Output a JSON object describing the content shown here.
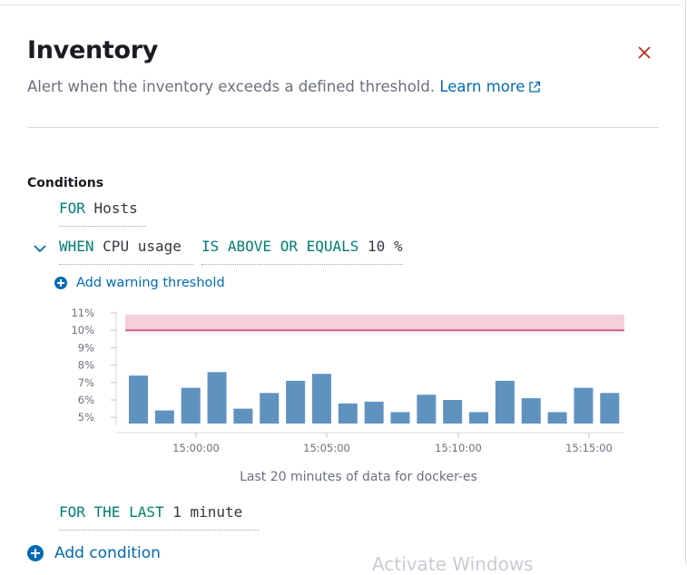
{
  "flyout": {
    "title": "Inventory",
    "description": "Alert when the inventory exceeds a defined threshold.",
    "learn_more": "Learn more",
    "close_icon": "close-icon"
  },
  "conditions": {
    "heading": "Conditions",
    "for_keyword": "FOR",
    "for_value": "Hosts",
    "when_keyword": "WHEN",
    "when_metric": "CPU usage",
    "comparator": "IS ABOVE OR EQUALS",
    "threshold_value": "10",
    "threshold_unit": "%",
    "add_warning": "Add warning threshold",
    "for_the_last_keyword": "FOR THE LAST",
    "for_the_last_value": "1 minute",
    "add_condition": "Add condition"
  },
  "chart_caption": "Last 20 minutes of data for docker-es",
  "watermark": "Activate Windows",
  "colors": {
    "accent": "#006bb4",
    "keyword": "#017d73",
    "bar": "#6092c0",
    "threshold_line": "#d36086",
    "threshold_band": "#f4cfdc",
    "close": "#bd271e"
  },
  "chart_data": {
    "type": "bar",
    "ylabel": "",
    "xlabel": "",
    "y_ticks": [
      "11%",
      "10%",
      "9%",
      "8%",
      "7%",
      "6%",
      "5%"
    ],
    "ylim": [
      4.7,
      11
    ],
    "x_ticks": [
      "15:00:00",
      "15:05:00",
      "15:10:00",
      "15:15:00"
    ],
    "threshold": 10,
    "values": [
      7.4,
      5.4,
      6.7,
      7.6,
      5.5,
      6.4,
      7.1,
      7.5,
      5.8,
      5.9,
      5.3,
      6.3,
      6.0,
      5.3,
      7.1,
      6.1,
      5.3,
      6.7,
      6.4
    ],
    "bar_color": "#6092c0"
  }
}
